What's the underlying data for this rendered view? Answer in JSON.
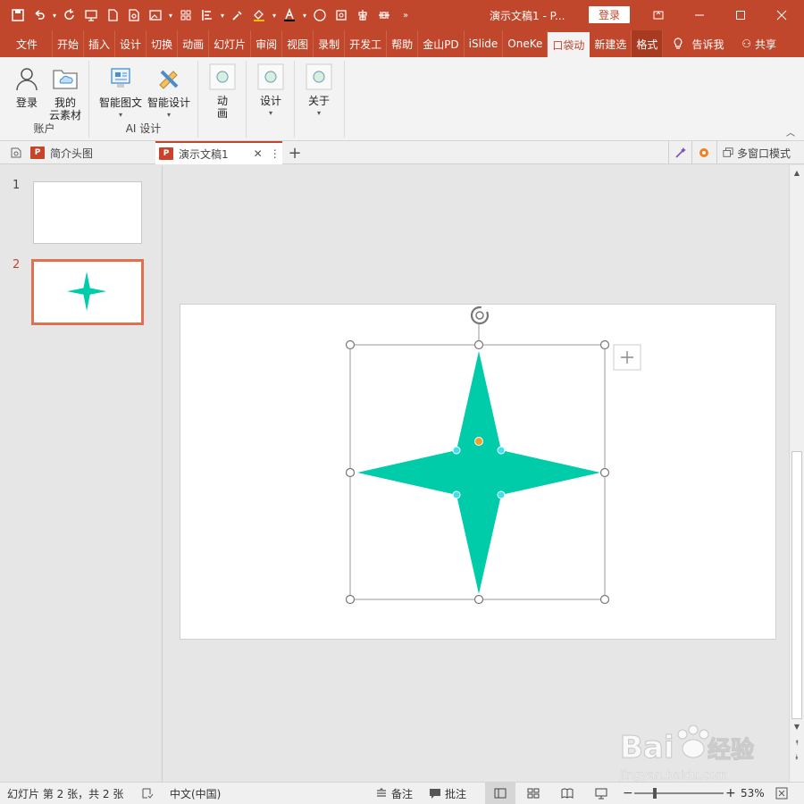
{
  "titlebar": {
    "doc_title": "演示文稿1 - P...",
    "login_label": "登录"
  },
  "tabs": [
    "文件",
    "开始",
    "插入",
    "设计",
    "切换",
    "动画",
    "幻灯片",
    "审阅",
    "视图",
    "录制",
    "开发工",
    "帮助",
    "金山PD",
    "iSlide",
    "OneKe",
    "口袋动",
    "新建选",
    "格式"
  ],
  "tabs_extra": {
    "tell_me": "告诉我",
    "share": "共享"
  },
  "ribbon": {
    "account": {
      "login": "登录",
      "cloud_line1": "我的",
      "cloud_line2": "云素材",
      "group": "账户"
    },
    "ai": {
      "smart_pic": "智能图文",
      "smart_design": "智能设计",
      "group": "AI 设计"
    },
    "anim": {
      "line1": "动",
      "line2": "画"
    },
    "design": {
      "label": "设计"
    },
    "about": {
      "label": "关于"
    }
  },
  "doc_tabs": {
    "tab1": "简介头图",
    "tab2": "演示文稿1",
    "multi_window": "多窗口模式"
  },
  "thumbnails": [
    {
      "num": "1"
    },
    {
      "num": "2"
    }
  ],
  "shape": {
    "fill": "#00ccaa",
    "name": "four-point-star"
  },
  "status": {
    "slide_info": "幻灯片 第 2 张，共 2 张",
    "language": "中文(中国)",
    "notes": "备注",
    "comments": "批注",
    "zoom": "53%"
  },
  "watermark": {
    "brand": "Bai",
    "brand2": "经验",
    "url": "jingyan.baidu.com"
  },
  "colors": {
    "accent": "#c0472c",
    "shape": "#00ccaa"
  }
}
